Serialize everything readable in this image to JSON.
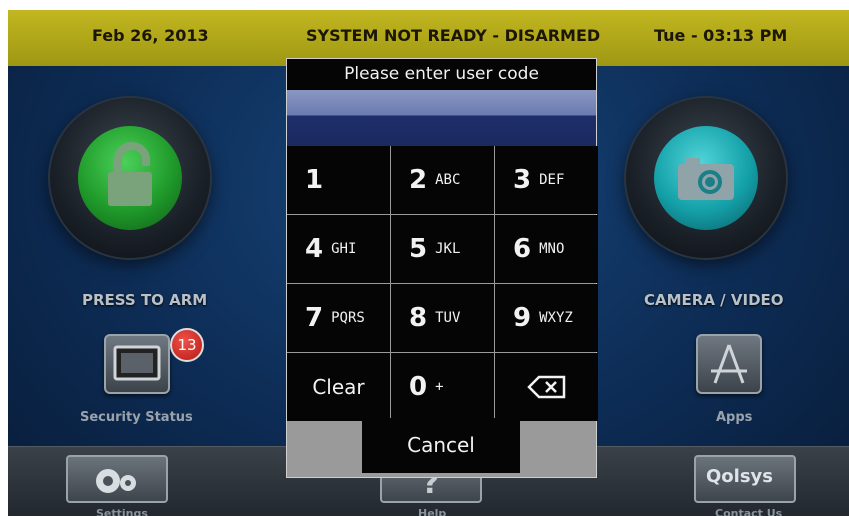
{
  "status_bar": {
    "date": "Feb 26, 2013",
    "system_status": "SYSTEM NOT READY - DISARMED",
    "time": "Tue - 03:13 PM"
  },
  "main": {
    "arm_label": "PRESS TO ARM",
    "camera_label": "CAMERA / VIDEO",
    "security_status_label": "Security Status",
    "security_badge_count": "13",
    "apps_label": "Apps",
    "arm_icon": "unlocked-padlock-icon",
    "camera_icon": "camera-icon"
  },
  "bottom_bar": {
    "settings_label": "Settings",
    "help_label": "Help",
    "contact_label": "Contact Us",
    "contact_logo_text": "Qolsys"
  },
  "dialog": {
    "title": "Please enter user code",
    "code_value": "",
    "keys": [
      {
        "num": "1",
        "letters": ""
      },
      {
        "num": "2",
        "letters": "ABC"
      },
      {
        "num": "3",
        "letters": "DEF"
      },
      {
        "num": "4",
        "letters": "GHI"
      },
      {
        "num": "5",
        "letters": "JKL"
      },
      {
        "num": "6",
        "letters": "MNO"
      },
      {
        "num": "7",
        "letters": "PQRS"
      },
      {
        "num": "8",
        "letters": "TUV"
      },
      {
        "num": "9",
        "letters": "WXYZ"
      },
      {
        "num": "0",
        "letters": "+"
      }
    ],
    "clear_label": "Clear",
    "backspace_icon": "backspace-icon",
    "cancel_label": "Cancel"
  },
  "colors": {
    "status_bar": "#b5ab1b",
    "background": "#0d2c55",
    "arm_green": "#1f9a2a",
    "camera_teal": "#14a0a8",
    "badge_red": "#c8241c"
  }
}
